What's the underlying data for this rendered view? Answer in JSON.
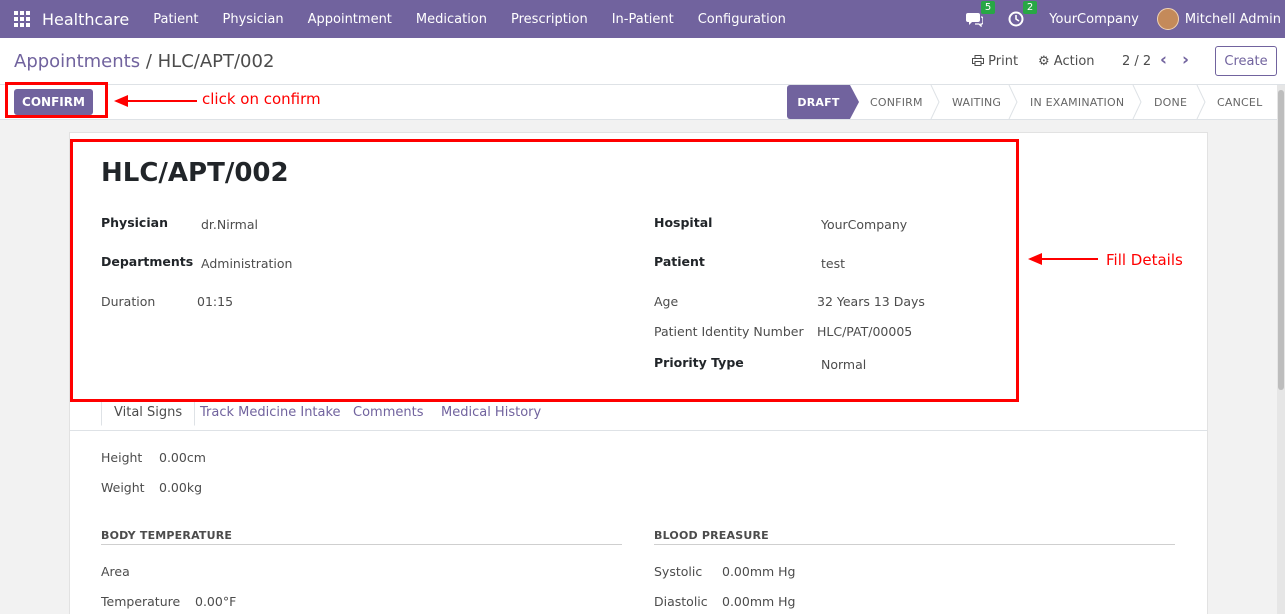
{
  "navbar": {
    "brand": "Healthcare",
    "menu": [
      "Patient",
      "Physician",
      "Appointment",
      "Medication",
      "Prescription",
      "In-Patient",
      "Configuration"
    ],
    "messages_count": "5",
    "activities_count": "2",
    "company": "YourCompany",
    "user": "Mitchell Admin"
  },
  "control_panel": {
    "breadcrumb_parent": "Appointments",
    "breadcrumb_sep": " / ",
    "breadcrumb_current": "HLC/APT/002",
    "print_label": "Print",
    "action_label": "Action",
    "pager": "2 / 2",
    "create_label": "Create"
  },
  "statusbar": {
    "confirm_button": "CONFIRM",
    "stages": [
      "DRAFT",
      "CONFIRM",
      "WAITING",
      "IN EXAMINATION",
      "DONE",
      "CANCEL"
    ],
    "active_stage": "DRAFT"
  },
  "record": {
    "title": "HLC/APT/002",
    "left_fields": [
      {
        "label": "Physician",
        "value": "dr.Nirmal"
      },
      {
        "label": "Departments",
        "value": "Administration"
      },
      {
        "label": "Duration",
        "value": "01:15"
      }
    ],
    "right_fields": [
      {
        "label": "Hospital",
        "value": "YourCompany"
      },
      {
        "label": "Patient",
        "value": "test"
      },
      {
        "label": "Age",
        "value": "32 Years 13 Days"
      },
      {
        "label": "Patient Identity Number",
        "value": "HLC/PAT/00005"
      },
      {
        "label": "Priority Type",
        "value": "Normal"
      }
    ]
  },
  "tabs": [
    "Vital Signs",
    "Track Medicine Intake",
    "Comments",
    "Medical History"
  ],
  "vitals": {
    "height_label": "Height",
    "height_value": "0.00cm",
    "weight_label": "Weight",
    "weight_value": "0.00kg",
    "body_temp_title": "BODY TEMPERATURE",
    "area_label": "Area",
    "temperature_label": "Temperature",
    "temperature_value": "0.00°F",
    "blood_pressure_title": "BLOOD PREASURE",
    "systolic_label": "Systolic",
    "systolic_value": "0.00mm Hg",
    "diastolic_label": "Diastolic",
    "diastolic_value": "0.00mm Hg"
  },
  "annotations": {
    "confirm_note": "click on confirm",
    "fill_note": "Fill Details",
    "color": "#ff0000"
  },
  "colors": {
    "brand": "#71639e"
  }
}
